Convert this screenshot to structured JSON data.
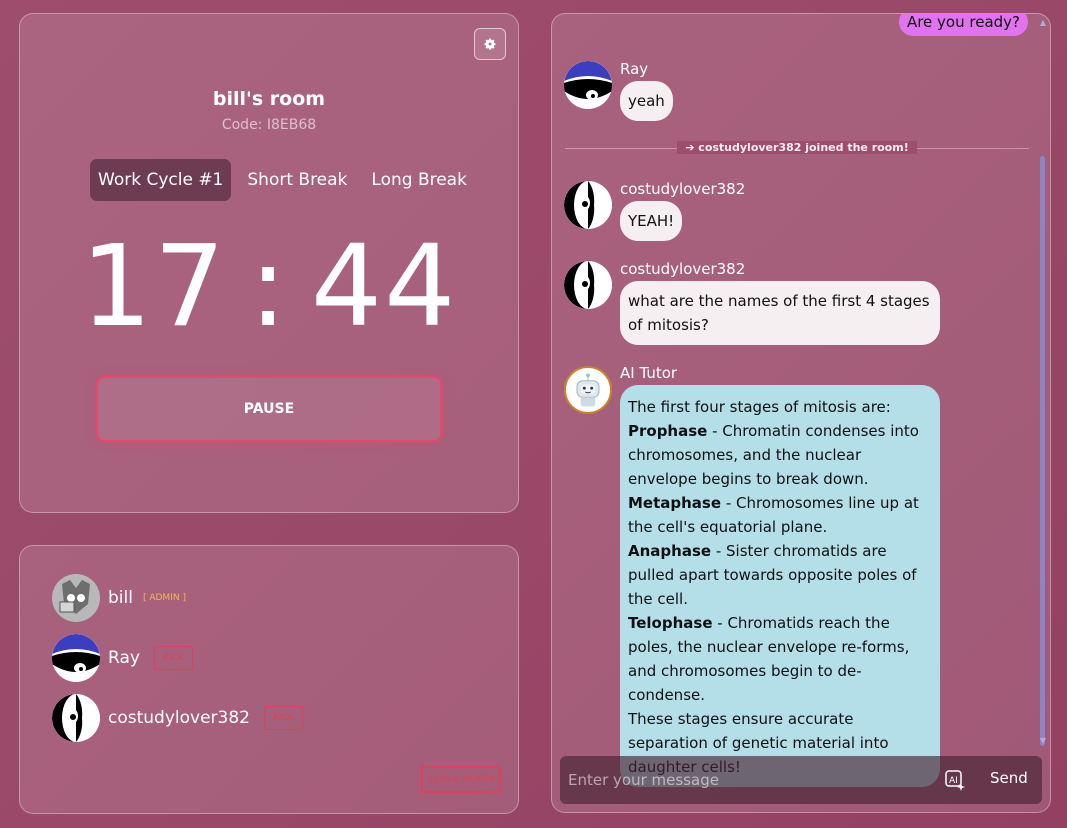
{
  "room": {
    "title": "bill's room",
    "code": "Code: I8EB68",
    "tabs": [
      "Work Cycle #1",
      "Short Break",
      "Long Break"
    ],
    "timer_minutes": "17",
    "timer_separator": ":",
    "timer_seconds": "44",
    "pause_label": "PAUSE"
  },
  "members": [
    {
      "name": "bill",
      "badge": "[ ADMIN ]"
    },
    {
      "name": "Ray",
      "action": "KICK"
    },
    {
      "name": "costudylover382",
      "action": "KICK"
    }
  ],
  "leave_label": "LEAVE ROOM",
  "chat": {
    "my_message": "Are you ready?",
    "messages": [
      {
        "sender": "Ray",
        "text": "yeah"
      },
      {
        "sender": "costudylover382",
        "text": "YEAH!"
      },
      {
        "sender": "costudylover382",
        "text": "what are the names of the first 4 stages of mitosis?"
      }
    ],
    "join_notice": "➔ costudylover382 joined the room!",
    "ai": {
      "sender": "AI Tutor",
      "intro": "The first four stages of mitosis are:",
      "stages": [
        {
          "name": "Prophase",
          "desc": " - Chromatin condenses into chromosomes, and the nuclear envelope begins to break down."
        },
        {
          "name": "Metaphase",
          "desc": " - Chromosomes line up at the cell's equatorial plane."
        },
        {
          "name": "Anaphase",
          "desc": " - Sister chromatids are pulled apart towards opposite poles of the cell."
        },
        {
          "name": "Telophase",
          "desc": " - Chromatids reach the poles, the nuclear envelope re-forms, and chromosomes begin to de-condense."
        }
      ],
      "outro": "These stages ensure accurate separation of genetic material into daughter cells!"
    },
    "input_placeholder": "Enter your message",
    "send_label": "Send"
  },
  "colors": {
    "accent_pink": "#e8456f",
    "kick_red": "#e0405a",
    "admin_gold": "#f0b84a",
    "my_bubble": "#e173ee",
    "ai_bubble": "#b4dee8"
  },
  "icons": [
    "gear-icon",
    "ai-sparkle-icon",
    "arrow-right-icon"
  ]
}
